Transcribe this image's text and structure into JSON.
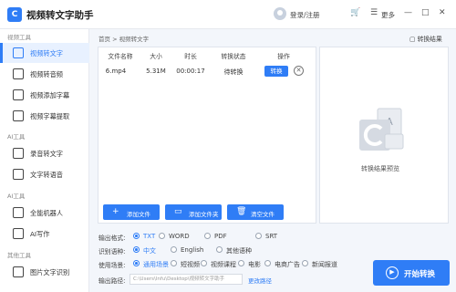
{
  "app": {
    "title": "视频转文字助手",
    "logo_text": "C"
  },
  "header": {
    "login_label": "登录/注册",
    "more_label": "更多"
  },
  "sidebar": {
    "sections": [
      {
        "label": "视频工具",
        "items": [
          {
            "label": "视频转文字",
            "icon": "video-text-icon",
            "active": true
          },
          {
            "label": "视频转音频",
            "icon": "video-audio-icon"
          },
          {
            "label": "视频添加字幕",
            "icon": "subtitle-add-icon"
          },
          {
            "label": "视频字幕提取",
            "icon": "subtitle-extract-icon"
          }
        ]
      },
      {
        "label": "AI工具",
        "items": [
          {
            "label": "录音转文字",
            "icon": "recording-icon"
          },
          {
            "label": "文字转语音",
            "icon": "tts-icon"
          }
        ]
      },
      {
        "label": "AI工具",
        "items": [
          {
            "label": "全能机器人",
            "icon": "robot-icon"
          },
          {
            "label": "AI写作",
            "icon": "ai-write-icon"
          }
        ]
      },
      {
        "label": "其他工具",
        "items": [
          {
            "label": "图片文字识别",
            "icon": "ocr-icon"
          }
        ]
      }
    ]
  },
  "breadcrumb": "首页 > 视频转文字",
  "result_link": "转换结果",
  "table": {
    "headers": [
      "文件名称",
      "大小",
      "时长",
      "转换状态",
      "操作"
    ],
    "rows": [
      {
        "name": "6.mp4",
        "size": "5.31M",
        "duration": "00:00:17",
        "status": "待转换",
        "action": "转换"
      }
    ]
  },
  "buttons": {
    "add_file": "添加文件",
    "add_folder": "添加文件夹",
    "clear_files": "清空文件"
  },
  "preview_label": "转换结果预览",
  "options": {
    "format": {
      "label": "输出格式:",
      "choices": [
        "TXT",
        "WORD",
        "PDF",
        "SRT"
      ],
      "selected": "TXT"
    },
    "lang": {
      "label": "识别语种:",
      "choices": [
        "中文",
        "English",
        "其他语种"
      ],
      "selected": "中文"
    },
    "scene": {
      "label": "使用场景:",
      "choices": [
        "通用场景",
        "短视频",
        "视频课程",
        "电影",
        "电商广告",
        "新闻报道"
      ],
      "selected": "通用场景"
    },
    "path": {
      "label": "输出路径:",
      "value": "C:\\Users\\lnfu\\Desktop\\视频转文字助手",
      "change_label": "更改路径"
    }
  },
  "start_label": "开始转换",
  "colors": {
    "accent": "#2f7df6",
    "sidebar_active_bg": "#e8f1ff"
  }
}
